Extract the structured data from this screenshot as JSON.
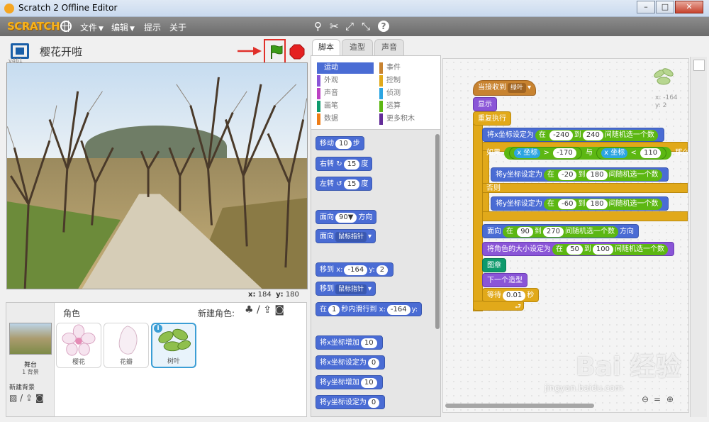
{
  "window": {
    "title": "Scratch 2 Offline Editor"
  },
  "menubar": {
    "logo": "SCRATCH",
    "menus": [
      "文件",
      "编辑",
      "提示",
      "关于"
    ]
  },
  "stage": {
    "version": "v461",
    "project_title": "樱花开啦",
    "coords": {
      "x_label": "x:",
      "x": "184",
      "y_label": "y:",
      "y": "180"
    }
  },
  "sprites": {
    "header": "角色",
    "new_sprite_label": "新建角色:",
    "stage_label": "舞台",
    "stage_bg_count": "1 背景",
    "new_bg_label": "新建背景",
    "items": [
      {
        "name": "樱花"
      },
      {
        "name": "花瓣"
      },
      {
        "name": "树叶",
        "selected": true
      }
    ]
  },
  "tabs": [
    "脚本",
    "造型",
    "声音"
  ],
  "categories": [
    {
      "label": "运动",
      "color": "#4a6cd4"
    },
    {
      "label": "外观",
      "color": "#8a55d7"
    },
    {
      "label": "声音",
      "color": "#bb42c3"
    },
    {
      "label": "画笔",
      "color": "#0e9a6c"
    },
    {
      "label": "数据",
      "color": "#ee7d16"
    },
    {
      "label": "事件",
      "color": "#c88330"
    },
    {
      "label": "控制",
      "color": "#e1a91a"
    },
    {
      "label": "侦测",
      "color": "#2ca5e2"
    },
    {
      "label": "运算",
      "color": "#5cb712"
    },
    {
      "label": "更多积木",
      "color": "#632d99"
    }
  ],
  "palette": {
    "move": {
      "pre": "移动",
      "val": "10",
      "post": "步"
    },
    "turn_right": {
      "pre": "右转",
      "icon": "↻",
      "val": "15",
      "post": "度"
    },
    "turn_left": {
      "pre": "左转",
      "icon": "↺",
      "val": "15",
      "post": "度"
    },
    "point_dir": {
      "pre": "面向",
      "val": "90▼",
      "post": "方向"
    },
    "point_towards": {
      "pre": "面向",
      "dd": "鼠标指针"
    },
    "goto_xy": {
      "pre": "移到",
      "x_label": "x:",
      "x": "-164",
      "y_label": "y:",
      "y": "2"
    },
    "goto": {
      "pre": "移到",
      "dd": "鼠标指针"
    },
    "glide": {
      "pre": "在",
      "secs": "1",
      "mid": "秒内滑行到",
      "x_label": "x:",
      "x": "-164",
      "y_label": "y:"
    },
    "change_x": {
      "pre": "将x坐标增加",
      "val": "10"
    },
    "set_x": {
      "pre": "将x坐标设定为",
      "val": "0"
    },
    "change_y": {
      "pre": "将y坐标增加",
      "val": "10"
    },
    "set_y": {
      "pre": "将y坐标设定为",
      "val": "0"
    }
  },
  "script": {
    "hat": {
      "pre": "当接收到",
      "dd": "绿叶"
    },
    "show": "显示",
    "forever": "重复执行",
    "set_x": {
      "pre": "将x坐标设定为",
      "in": "在",
      "a": "-240",
      "to": "到",
      "b": "240",
      "post": "间随机选一个数"
    },
    "if": {
      "pre": "如果",
      "xpos": "x 坐标",
      "gt": ">",
      "v1": "-170",
      "and": "与",
      "xpos2": "x 坐标",
      "lt": "<",
      "v2": "110",
      "then": "那么"
    },
    "set_y1": {
      "pre": "将y坐标设定为",
      "in": "在",
      "a": "-20",
      "to": "到",
      "b": "180",
      "post": "间随机选一个数"
    },
    "else": "否则",
    "set_y2": {
      "pre": "将y坐标设定为",
      "in": "在",
      "a": "-60",
      "to": "到",
      "b": "180",
      "post": "间随机选一个数"
    },
    "point": {
      "pre": "面向",
      "in": "在",
      "a": "90",
      "to": "到",
      "b": "270",
      "post": "间随机选一个数",
      "end": "方向"
    },
    "size": {
      "pre": "将角色的大小设定为",
      "in": "在",
      "a": "50",
      "to": "到",
      "b": "100",
      "post": "间随机选一个数"
    },
    "layer": "图章",
    "next_costume": "下一个造型",
    "wait": {
      "pre": "等待",
      "val": "0.01",
      "post": "秒"
    }
  },
  "sprite_info": {
    "x_label": "x:",
    "x": "-164",
    "y_label": "y:",
    "y": "2"
  },
  "watermark": {
    "text": "Bai 经验",
    "url": "jingyan.baidu.com"
  }
}
